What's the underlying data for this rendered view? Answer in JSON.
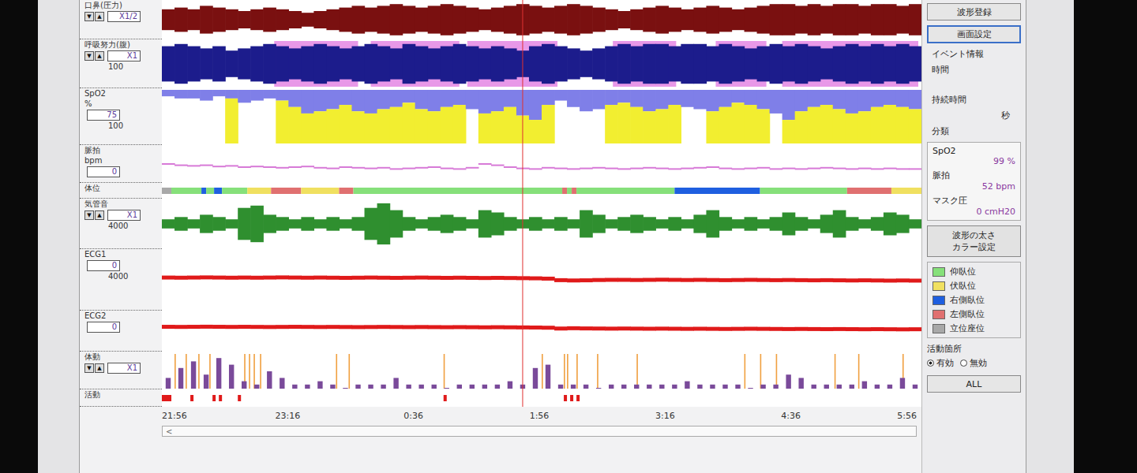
{
  "spinner_glyphs": [
    "▼",
    "▲"
  ],
  "channels": [
    {
      "kind": "envelope",
      "label": "口鼻(圧力)",
      "unit": null,
      "spinner": true,
      "box": "X1/2",
      "scale": null,
      "color": "#7a1010",
      "values": [
        6,
        7,
        6,
        8,
        7,
        6,
        5,
        6,
        7,
        6,
        5,
        4,
        5,
        6,
        7,
        8,
        7,
        8,
        9,
        8,
        7,
        8,
        9,
        8,
        7,
        6,
        7,
        8,
        9,
        8,
        7,
        8,
        9,
        8,
        7,
        6,
        5,
        6,
        7,
        8,
        7,
        6,
        7,
        8,
        7,
        6,
        7,
        8,
        9,
        9,
        8,
        9,
        8,
        9,
        9,
        8,
        9,
        9,
        8,
        9
      ],
      "events": [],
      "event_color": null
    },
    {
      "kind": "envelope",
      "label": "呼吸努力(腹)",
      "unit": null,
      "spinner": true,
      "box": "X1",
      "scale": "100",
      "color": "#1c1c8c",
      "values": [
        8,
        9,
        8,
        7,
        8,
        6,
        7,
        8,
        9,
        8,
        7,
        8,
        9,
        8,
        7,
        8,
        9,
        8,
        7,
        9,
        8,
        7,
        8,
        9,
        8,
        7,
        8,
        7,
        6,
        8,
        9,
        8,
        7,
        6,
        7,
        8,
        9,
        8,
        9,
        9,
        8,
        9,
        9,
        8,
        9,
        8,
        7,
        8,
        9,
        8,
        9,
        8,
        7,
        8,
        9,
        8,
        9,
        8,
        9,
        8
      ],
      "events": [
        [
          71,
          124
        ],
        [
          132,
          188
        ],
        [
          193,
          250
        ],
        [
          285,
          325
        ],
        [
          350,
          382
        ],
        [
          392,
          478
        ]
      ],
      "event_color": "#e27ee2"
    },
    {
      "kind": "spo2",
      "label": "SpO2",
      "unit": "%",
      "spinner": false,
      "box": "75",
      "scale": "100",
      "color": "#7f7fe8",
      "values": [
        97,
        96,
        96,
        95,
        97,
        96,
        94,
        95,
        96,
        95,
        92,
        89,
        90,
        91,
        93,
        90,
        89,
        91,
        92,
        94,
        91,
        90,
        92,
        93,
        91,
        89,
        90,
        92,
        88,
        86,
        93,
        95,
        92,
        90,
        91,
        93,
        94,
        92,
        90,
        91,
        93,
        92,
        91,
        90,
        92,
        94,
        93,
        91,
        89,
        86,
        90,
        92,
        93,
        91,
        89,
        90,
        92,
        93,
        92,
        91
      ],
      "events": [
        [
          15,
          20
        ],
        [
          40,
          45
        ],
        [
          71,
          125
        ],
        [
          130,
          190
        ],
        [
          200,
          250
        ],
        [
          280,
          330
        ],
        [
          345,
          385
        ],
        [
          392,
          478
        ]
      ],
      "event_color": "#f2ee30"
    },
    {
      "kind": "trend",
      "label": "脈拍",
      "unit": "bpm",
      "spinner": false,
      "box": "0",
      "scale": null,
      "color": "#d77ad7",
      "values": [
        60,
        58,
        57,
        58,
        56,
        57,
        55,
        56,
        55,
        54,
        55,
        56,
        54,
        53,
        55,
        54,
        53,
        54,
        52,
        53,
        54,
        55,
        53,
        52,
        54,
        60,
        58,
        55,
        53,
        52,
        54,
        53,
        52,
        53,
        54,
        53,
        52,
        53,
        54,
        53,
        52,
        53,
        54,
        55,
        53,
        52,
        53,
        54,
        52,
        53,
        52,
        53,
        54,
        53,
        52,
        53,
        52,
        53,
        52,
        52
      ]
    },
    {
      "kind": "position",
      "label": "体位",
      "unit": null,
      "spinner": false,
      "box": null,
      "scale": null,
      "segments": [
        {
          "legend": 4,
          "duration_min": 6
        },
        {
          "legend": 0,
          "duration_min": 19
        },
        {
          "legend": 2,
          "duration_min": 3
        },
        {
          "legend": 0,
          "duration_min": 5
        },
        {
          "legend": 2,
          "duration_min": 5
        },
        {
          "legend": 0,
          "duration_min": 16
        },
        {
          "legend": 1,
          "duration_min": 15
        },
        {
          "legend": 3,
          "duration_min": 19
        },
        {
          "legend": 1,
          "duration_min": 24
        },
        {
          "legend": 3,
          "duration_min": 9
        },
        {
          "legend": 0,
          "duration_min": 132
        },
        {
          "legend": 3,
          "duration_min": 3
        },
        {
          "legend": 0,
          "duration_min": 3
        },
        {
          "legend": 3,
          "duration_min": 3
        },
        {
          "legend": 0,
          "duration_min": 62
        },
        {
          "legend": 2,
          "duration_min": 54
        },
        {
          "legend": 0,
          "duration_min": 55
        },
        {
          "legend": 3,
          "duration_min": 28
        },
        {
          "legend": 1,
          "duration_min": 19
        }
      ]
    },
    {
      "kind": "envelope",
      "label": "気管音",
      "unit": null,
      "spinner": true,
      "box": "X1",
      "scale": "4000",
      "color": "#2f8f2f",
      "values": [
        2,
        3,
        2,
        4,
        3,
        2,
        7,
        8,
        4,
        3,
        2,
        3,
        2,
        3,
        2,
        3,
        7,
        9,
        6,
        3,
        2,
        3,
        4,
        3,
        2,
        6,
        5,
        3,
        2,
        3,
        2,
        3,
        2,
        6,
        4,
        2,
        3,
        4,
        3,
        2,
        3,
        2,
        4,
        6,
        3,
        2,
        3,
        2,
        3,
        5,
        3,
        2,
        4,
        6,
        3,
        2,
        3,
        5,
        4,
        2
      ],
      "events": [],
      "event_color": null
    },
    {
      "kind": "ecg",
      "label": "ECG1",
      "unit": null,
      "spinner": false,
      "box": "0",
      "scale": "4000",
      "color": "#e01a1a",
      "values": [
        2150,
        2140,
        2150,
        2160,
        2150,
        2140,
        2150,
        2140,
        2150,
        2160,
        2150,
        2140,
        2150,
        2140,
        2130,
        2140,
        2150,
        2140,
        2130,
        2140,
        2150,
        2140,
        2130,
        2140,
        2130,
        2120,
        2130,
        2120,
        2110,
        2100,
        2080,
        1980,
        1960,
        1970,
        1990,
        2000,
        2000,
        1990,
        2000,
        2010,
        2000,
        1990,
        2000,
        1990,
        1980,
        1990,
        2000,
        1990,
        1980,
        1990,
        1980,
        1970,
        1980,
        1970,
        1960,
        1970,
        1960,
        1950,
        1960,
        1950
      ]
    },
    {
      "kind": "ecg",
      "label": "ECG2",
      "unit": null,
      "spinner": false,
      "box": "0",
      "scale": null,
      "color": "#e01a1a",
      "values": [
        2420,
        2410,
        2420,
        2430,
        2420,
        2410,
        2420,
        2410,
        2400,
        2410,
        2420,
        2410,
        2400,
        2410,
        2400,
        2390,
        2400,
        2410,
        2400,
        2390,
        2400,
        2390,
        2380,
        2390,
        2380,
        2370,
        2380,
        2370,
        2360,
        2350,
        2330,
        2250,
        2280,
        2260,
        2250,
        2240,
        2250,
        2240,
        2230,
        2240,
        2230,
        2220,
        2230,
        2220,
        2210,
        2220,
        2230,
        2220,
        2210,
        2200,
        2210,
        2200,
        2190,
        2200,
        2190,
        2180,
        2190,
        2180,
        2170,
        2180
      ]
    },
    {
      "kind": "movement",
      "label": "体動",
      "unit": null,
      "spinner": true,
      "box": "X1",
      "scale": null,
      "color": "#7a4a9a",
      "marker_color": "#f0a040",
      "values": [
        3,
        6,
        8,
        4,
        9,
        7,
        2,
        1,
        5,
        3,
        1,
        1,
        2,
        1,
        0,
        1,
        1,
        1,
        3,
        1,
        1,
        1,
        0,
        1,
        1,
        1,
        1,
        2,
        1,
        6,
        7,
        1,
        1,
        1,
        0,
        1,
        1,
        1,
        1,
        1,
        1,
        2,
        1,
        1,
        1,
        1,
        0,
        1,
        1,
        4,
        3,
        1,
        1,
        1,
        1,
        2,
        1,
        1,
        3,
        1
      ],
      "markers": [
        8,
        15,
        23,
        30,
        52,
        55,
        58,
        62,
        110,
        118,
        178,
        240,
        254,
        256,
        262,
        275,
        300,
        368,
        378,
        388,
        425,
        440,
        468
      ]
    },
    {
      "kind": "activity",
      "label": "活動",
      "unit": null,
      "spinner": false,
      "box": null,
      "scale": null,
      "color": "#e01a1a",
      "marks": [
        [
          0,
          6
        ],
        [
          18,
          20
        ],
        [
          32,
          34
        ],
        [
          36,
          38
        ],
        [
          48,
          50
        ],
        [
          178,
          180
        ],
        [
          254,
          256
        ],
        [
          258,
          260
        ],
        [
          262,
          264
        ]
      ]
    }
  ],
  "timeline": {
    "span_min": 480,
    "cursor_min": 228,
    "ticks": [
      {
        "label": "21:56",
        "min": 0
      },
      {
        "label": "23:16",
        "min": 80
      },
      {
        "label": "0:36",
        "min": 160
      },
      {
        "label": "1:56",
        "min": 240
      },
      {
        "label": "3:16",
        "min": 320
      },
      {
        "label": "4:36",
        "min": 400
      },
      {
        "label": "5:56",
        "min": 480
      }
    ]
  },
  "scrollbar": {
    "left_glyph": "<"
  },
  "right_panel": {
    "buttons": [
      {
        "label": "波形登録",
        "selected": false
      },
      {
        "label": "画面設定",
        "selected": true
      }
    ],
    "event_info": {
      "title": "イベント情報",
      "time_label": "時間",
      "duration_label": "持続時間",
      "duration_unit": "秒",
      "class_label": "分類"
    },
    "readings": [
      {
        "label": "SpO2",
        "value": "99",
        "unit": "%"
      },
      {
        "label": "脈拍",
        "value": "52",
        "unit": "bpm"
      },
      {
        "label": "マスク圧",
        "value": "0",
        "unit": "cmH20"
      }
    ],
    "color_button": [
      "波形の太さ",
      "カラー設定"
    ],
    "legend": [
      {
        "label": "仰臥位",
        "color": "#86e07a"
      },
      {
        "label": "伏臥位",
        "color": "#f0e060"
      },
      {
        "label": "右側臥位",
        "color": "#1f5fe0"
      },
      {
        "label": "左側臥位",
        "color": "#e07070"
      },
      {
        "label": "立位座位",
        "color": "#a8a8a8"
      }
    ],
    "activity_area": {
      "title": "活動箇所",
      "options": [
        {
          "label": "有効",
          "selected": true
        },
        {
          "label": "無効",
          "selected": false
        }
      ]
    },
    "all_button": "ALL"
  }
}
